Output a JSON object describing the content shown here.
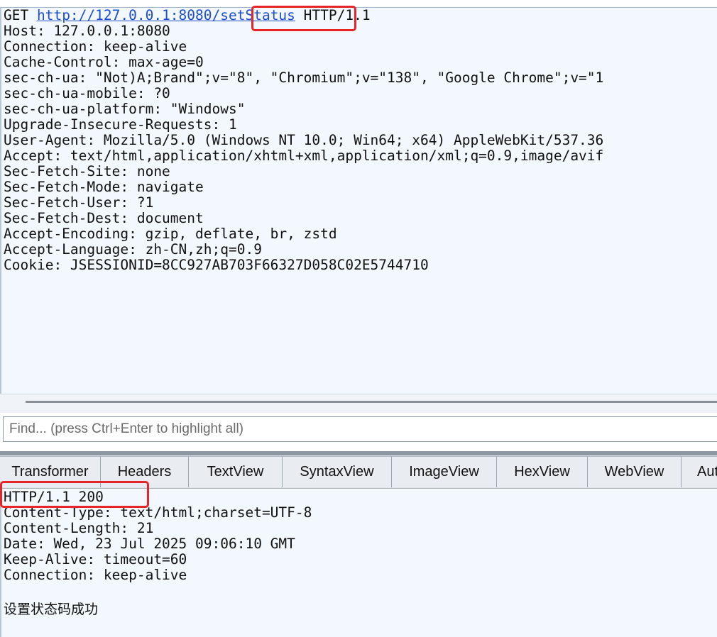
{
  "request": {
    "method": "GET ",
    "url_host": "http://127.0.0.1:8080",
    "url_path": "/setStatus",
    "protocol": " HTTP/1.1",
    "headers": [
      "Host: 127.0.0.1:8080",
      "Connection: keep-alive",
      "Cache-Control: max-age=0",
      "sec-ch-ua: \"Not)A;Brand\";v=\"8\", \"Chromium\";v=\"138\", \"Google Chrome\";v=\"1",
      "sec-ch-ua-mobile: ?0",
      "sec-ch-ua-platform: \"Windows\"",
      "Upgrade-Insecure-Requests: 1",
      "User-Agent: Mozilla/5.0 (Windows NT 10.0; Win64; x64) AppleWebKit/537.36",
      "Accept: text/html,application/xhtml+xml,application/xml;q=0.9,image/avif",
      "Sec-Fetch-Site: none",
      "Sec-Fetch-Mode: navigate",
      "Sec-Fetch-User: ?1",
      "Sec-Fetch-Dest: document",
      "Accept-Encoding: gzip, deflate, br, zstd",
      "Accept-Language: zh-CN,zh;q=0.9",
      "Cookie: JSESSIONID=8CC927AB703F66327D058C02E5744710"
    ]
  },
  "find": {
    "placeholder": "Find... (press Ctrl+Enter to highlight all)"
  },
  "tabs": [
    "Transformer",
    "Headers",
    "TextView",
    "SyntaxView",
    "ImageView",
    "HexView",
    "WebView",
    "Auth"
  ],
  "response": {
    "status_line": "HTTP/1.1 200",
    "headers": [
      "Content-Type: text/html;charset=UTF-8",
      "Content-Length: 21",
      "Date: Wed, 23 Jul 2025 09:06:10 GMT",
      "Keep-Alive: timeout=60",
      "Connection: keep-alive"
    ],
    "body": "设置状态码成功"
  },
  "colors": {
    "highlight": "#e5252a",
    "link": "#1c4fd0",
    "pane_background": "#f2f8fd"
  }
}
